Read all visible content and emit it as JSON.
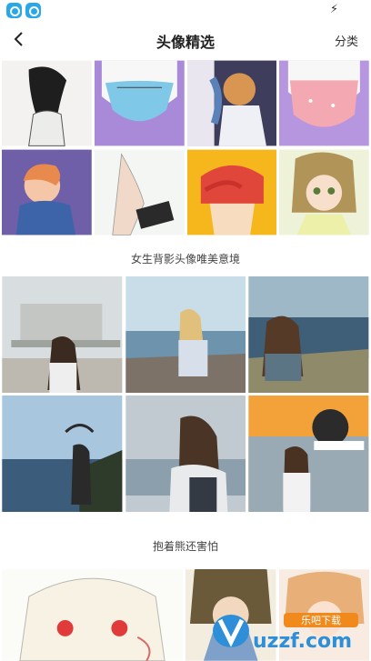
{
  "header": {
    "title": "头像精选",
    "category_label": "分类",
    "back_icon": "back-arrow-icon"
  },
  "status_bar": {
    "app_icons": [
      "app-icon",
      "app-icon"
    ],
    "bolt_icon": "bolt-icon"
  },
  "sections": [
    {
      "label": "",
      "tiles": 8
    },
    {
      "label": "女生背影头像唯美意境",
      "tiles": 6
    },
    {
      "label": "抱着熊还害怕",
      "tiles": 3
    }
  ],
  "watermark": {
    "brand": "uzzf.com",
    "tagline": "乐吧下载"
  }
}
